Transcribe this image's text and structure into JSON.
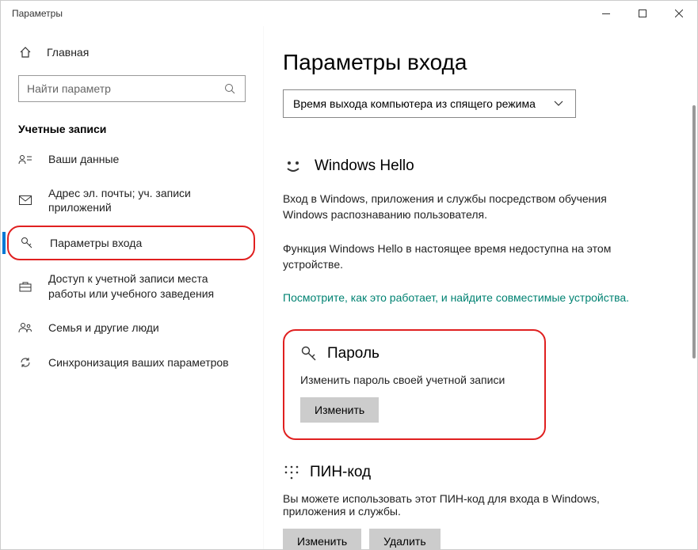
{
  "window": {
    "title": "Параметры"
  },
  "sidebar": {
    "home": "Главная",
    "search_placeholder": "Найти параметр",
    "section": "Учетные записи",
    "items": [
      {
        "label": "Ваши данные"
      },
      {
        "label": "Адрес эл. почты; уч. записи приложений"
      },
      {
        "label": "Параметры входа"
      },
      {
        "label": "Доступ к учетной записи места работы или учебного заведения"
      },
      {
        "label": "Семья и другие люди"
      },
      {
        "label": "Синхронизация ваших параметров"
      }
    ]
  },
  "main": {
    "title": "Параметры входа",
    "dropdown": "Время выхода компьютера из спящего режима",
    "hello": {
      "title": "Windows Hello",
      "desc": "Вход в Windows, приложения и службы посредством обучения Windows распознаванию пользователя.",
      "unavailable": "Функция Windows Hello в настоящее время недоступна на этом устройстве.",
      "link": "Посмотрите, как это работает, и найдите совместимые устройства."
    },
    "password": {
      "title": "Пароль",
      "desc": "Изменить пароль своей учетной записи",
      "button": "Изменить"
    },
    "pin": {
      "title": "ПИН-код",
      "desc": "Вы можете использовать этот ПИН-код для входа в Windows, приложения и службы.",
      "change": "Изменить",
      "remove": "Удалить"
    }
  }
}
